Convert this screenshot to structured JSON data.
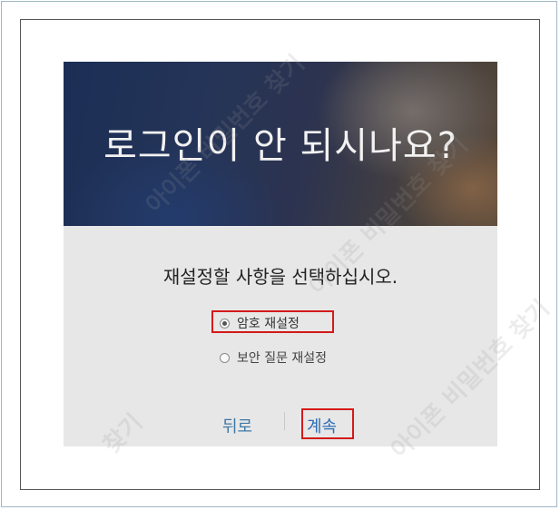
{
  "dialog": {
    "banner_title": "로그인이 안 되시나요?",
    "instruction": "재설정할 사항을 선택하십시오.",
    "options": [
      {
        "label": "암호 재설정",
        "selected": true
      },
      {
        "label": "보안 질문 재설정",
        "selected": false
      }
    ],
    "back_label": "뒤로",
    "continue_label": "계속"
  },
  "watermarks": [
    "아이폰 비밀번호 찾기",
    "아이폰 비밀번호 찾기",
    "아이폰 비밀번호 찾기",
    "찾기"
  ],
  "colors": {
    "highlight": "#d41a1a",
    "link": "#3e78a6",
    "dialog_bg": "#e7e7e7"
  }
}
